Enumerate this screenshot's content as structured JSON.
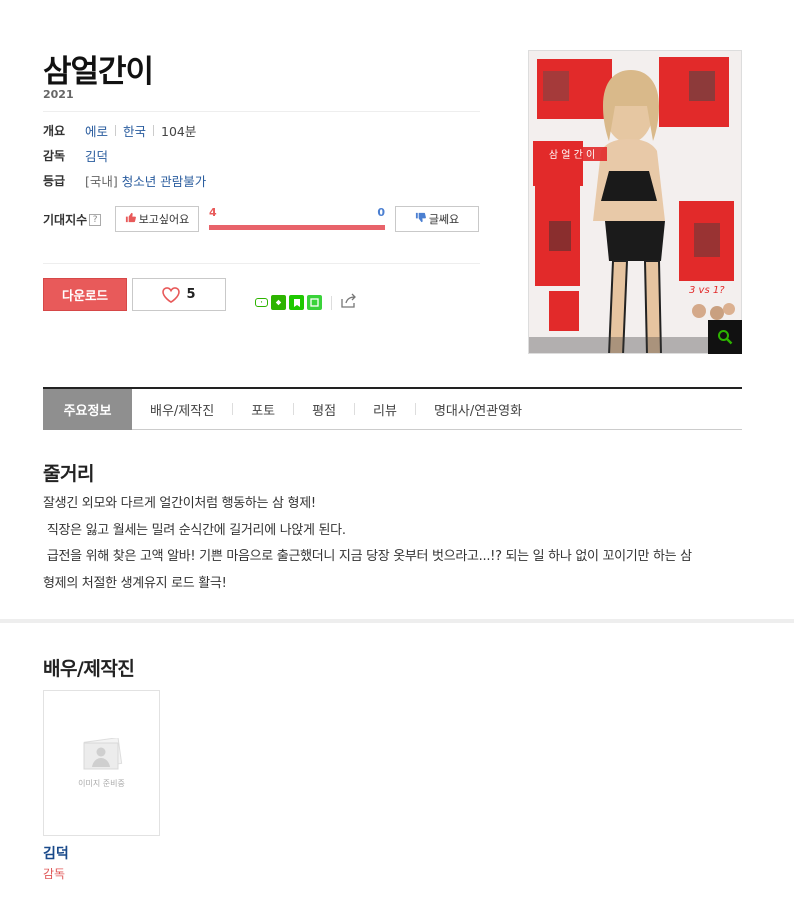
{
  "movie": {
    "title": "삼얼간이",
    "year": "2021"
  },
  "info": {
    "overview_label": "개요",
    "genre": "에로",
    "country": "한국",
    "runtime": "104분",
    "director_label": "감독",
    "director": "김덕",
    "rating_label": "등급",
    "rating_region": "[국내]",
    "rating": "청소년 관람불가"
  },
  "expectation": {
    "label": "기대지수",
    "help_icon": "?",
    "want_label": "보고싶어요",
    "meh_label": "글쎄요",
    "want_count": "4",
    "meh_count": "0",
    "want_fraction": 1.0
  },
  "actions": {
    "download_label": "다운로드",
    "like_count": "5"
  },
  "share": {
    "icons": [
      "band-icon",
      "naver-icon",
      "bookmark-icon",
      "line-icon",
      "share-icon"
    ]
  },
  "poster": {
    "main_text": "삼얼간이",
    "sub_text": "삼 얼 간 이",
    "tagline": "3 vs 1?",
    "icon": "magnifier-icon"
  },
  "tabs": [
    "주요정보",
    "배우/제작진",
    "포토",
    "평점",
    "리뷰",
    "명대사/연관영화"
  ],
  "synopsis": {
    "heading": "줄거리",
    "lines": [
      "잘생긴 외모와 다르게 얼간이처럼 행동하는 삼 형제!",
      " 직장은 잃고 월세는 밀려 순식간에 길거리에 나앉게 된다.",
      " 급전을 위해 찾은 고액 알바! 기쁜 마음으로 출근했더니 지금 당장 옷부터 벗으라고...!? 되는 일 하나 없이 꼬이기만 하는 삼",
      "형제의 처절한 생계유지 로드 활극!"
    ]
  },
  "cast": {
    "heading": "배우/제작진",
    "placeholder_text": "이미지 준비중",
    "members": [
      {
        "name": "김덕",
        "role": "감독"
      }
    ]
  },
  "colors": {
    "accent_red": "#e85a5a",
    "accent_blue": "#4b7fd1",
    "link_blue": "#2a5c9e"
  }
}
